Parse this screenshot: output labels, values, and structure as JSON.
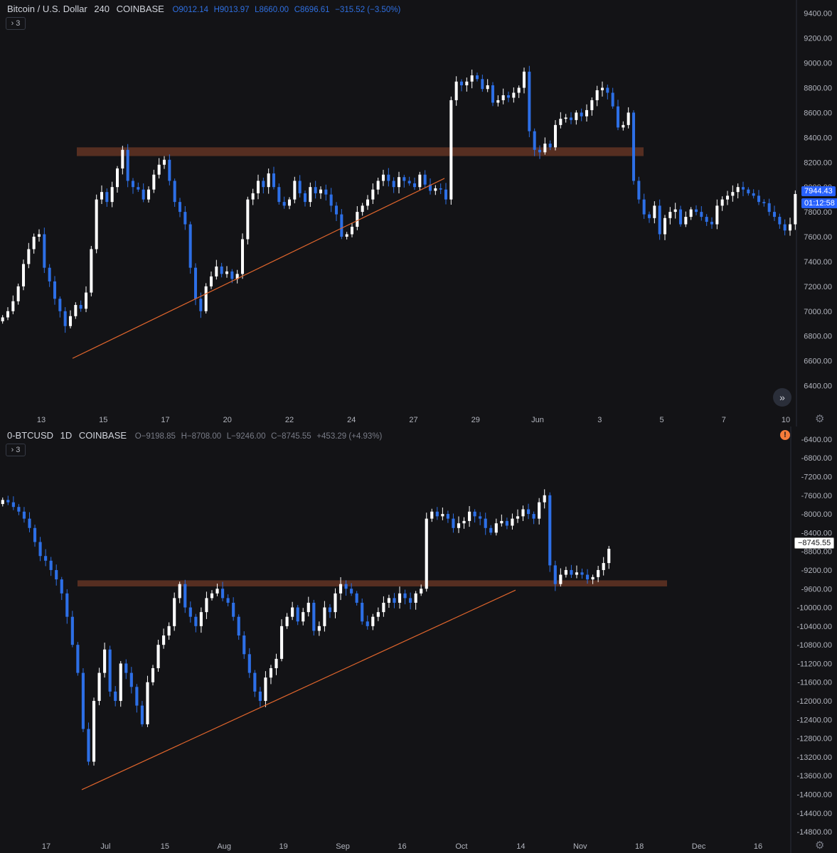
{
  "colors": {
    "background": "#131316",
    "up": "#ffffff",
    "down": "#2d6fe6",
    "zone": "#5a2f22",
    "trendline": "#e0652c",
    "axis_text": "#b2b5be"
  },
  "pane1": {
    "legend": {
      "symbol": "Bitcoin / U.S. Dollar",
      "interval": "240",
      "exchange": "COINBASE",
      "open": "O9012.14",
      "high": "H9013.97",
      "low": "L8660.00",
      "close": "C8696.61",
      "change": "−315.52 (−3.50%)"
    },
    "indicators_button": "3",
    "last_price": "7944.43",
    "countdown": "01:12:58",
    "nav_icon": "double-chevron-right-icon",
    "settings_icon": "gear-icon"
  },
  "pane2": {
    "legend": {
      "symbol": "0-BTCUSD",
      "interval": "1D",
      "exchange": "COINBASE",
      "open": "O−9198.85",
      "high": "H−8708.00",
      "low": "L−9246.00",
      "close": "C−8745.55",
      "change": "+453.29 (+4.93%)"
    },
    "indicators_button": "3",
    "last_price": "−8745.55",
    "warning_icon": "warning-icon",
    "settings_icon": "gear-icon"
  },
  "chart_data": [
    {
      "type": "candlestick",
      "title": "Bitcoin / U.S. Dollar",
      "interval": "240",
      "y_ticks": [
        "9400.00",
        "9200.00",
        "9000.00",
        "8800.00",
        "8600.00",
        "8400.00",
        "8200.00",
        "8000.00",
        "7800.00",
        "7600.00",
        "7400.00",
        "7200.00",
        "7000.00",
        "6800.00",
        "6600.00",
        "6400.00"
      ],
      "ylim": [
        6300,
        9450
      ],
      "x_ticks": [
        "13",
        "15",
        "17",
        "20",
        "22",
        "24",
        "27",
        "29",
        "Jun",
        "3",
        "5",
        "7",
        "10"
      ],
      "candles_close": [
        6950,
        7000,
        7080,
        7200,
        7380,
        7500,
        7600,
        7620,
        7350,
        7240,
        7100,
        7000,
        6880,
        6960,
        7050,
        7020,
        7150,
        7500,
        7900,
        7960,
        7880,
        8000,
        8150,
        8300,
        8050,
        8000,
        7980,
        7900,
        7980,
        8100,
        8180,
        8220,
        8050,
        7880,
        7800,
        7700,
        7350,
        7100,
        7000,
        7200,
        7280,
        7360,
        7300,
        7320,
        7260,
        7300,
        7580,
        7900,
        7950,
        8050,
        8000,
        8110,
        8000,
        7880,
        7850,
        7900,
        8050,
        7950,
        7880,
        8000,
        7950,
        7980,
        7940,
        7850,
        7780,
        7600,
        7620,
        7680,
        7800,
        7850,
        7900,
        7980,
        8050,
        8100,
        8050,
        8000,
        8080,
        8050,
        8030,
        8000,
        8100,
        8020,
        7970,
        7990,
        7980,
        7900,
        8700,
        8850,
        8820,
        8850,
        8900,
        8870,
        8790,
        8820,
        8680,
        8700,
        8740,
        8720,
        8760,
        8800,
        8930,
        8450,
        8300,
        8280,
        8350,
        8320,
        8500,
        8550,
        8560,
        8540,
        8600,
        8570,
        8620,
        8700,
        8780,
        8800,
        8760,
        8650,
        8480,
        8500,
        8600,
        8050,
        7900,
        7780,
        7750,
        7850,
        7620,
        7750,
        7800,
        7820,
        7700,
        7760,
        7820,
        7800,
        7760,
        7720,
        7700,
        7850,
        7900,
        7930,
        7960,
        8000,
        7980,
        7950,
        7930,
        7880,
        7870,
        7800,
        7760,
        7700,
        7650,
        7700,
        7944
      ],
      "zones": [
        {
          "y_low": 8250,
          "y_high": 8320
        }
      ],
      "trendlines": [
        {
          "from": [
            6620,
            "start"
          ],
          "to": [
            8070,
            "end"
          ]
        }
      ]
    },
    {
      "type": "candlestick",
      "title": "0-BTCUSD",
      "interval": "1D",
      "y_ticks": [
        "-6400.00",
        "-6800.00",
        "-7200.00",
        "-7600.00",
        "-8000.00",
        "-8400.00",
        "-8800.00",
        "-9200.00",
        "-9600.00",
        "-10000.00",
        "-10400.00",
        "-10800.00",
        "-11200.00",
        "-11600.00",
        "-12000.00",
        "-12400.00",
        "-12800.00",
        "-13200.00",
        "-13600.00",
        "-14000.00",
        "-14400.00",
        "-14800.00"
      ],
      "ylim": [
        -14950,
        -6250
      ],
      "x_ticks": [
        "17",
        "Jul",
        "15",
        "Aug",
        "19",
        "Sep",
        "16",
        "Oct",
        "14",
        "Nov",
        "18",
        "Dec",
        "16"
      ],
      "candles_close": [
        -7700,
        -7750,
        -7850,
        -7950,
        -8100,
        -8300,
        -8600,
        -8900,
        -9000,
        -9200,
        -9400,
        -9700,
        -10200,
        -10800,
        -11400,
        -12600,
        -13300,
        -12000,
        -11400,
        -10900,
        -11800,
        -12000,
        -11200,
        -11400,
        -11700,
        -12100,
        -12500,
        -11600,
        -11300,
        -10800,
        -10600,
        -10400,
        -9800,
        -9500,
        -10000,
        -10200,
        -10400,
        -10100,
        -9800,
        -9700,
        -9600,
        -9800,
        -9900,
        -10200,
        -10600,
        -11000,
        -11400,
        -11800,
        -12000,
        -11500,
        -11300,
        -11100,
        -10400,
        -10200,
        -10000,
        -10300,
        -10100,
        -9900,
        -10500,
        -10400,
        -10000,
        -10100,
        -9700,
        -9500,
        -9600,
        -9700,
        -9900,
        -10300,
        -10400,
        -10200,
        -10100,
        -9900,
        -9800,
        -9900,
        -9700,
        -9800,
        -9900,
        -9700,
        -9600,
        -8100,
        -7950,
        -8050,
        -8000,
        -8100,
        -8300,
        -8200,
        -8150,
        -7950,
        -8050,
        -8100,
        -8300,
        -8400,
        -8200,
        -8150,
        -8250,
        -8100,
        -8050,
        -7900,
        -8000,
        -8100,
        -7750,
        -7600,
        -9100,
        -9500,
        -9300,
        -9200,
        -9300,
        -9250,
        -9300,
        -9400,
        -9350,
        -9200,
        -9050,
        -8745
      ],
      "zones": [
        {
          "y_low": -9550,
          "y_high": -9420
        }
      ],
      "trendlines": [
        {
          "from": [
            -13900,
            "start"
          ],
          "to": [
            -9630,
            "end"
          ]
        }
      ]
    }
  ]
}
